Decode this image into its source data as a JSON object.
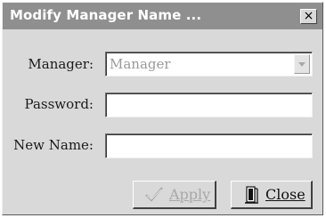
{
  "window": {
    "title": "Modify Manager Name ...",
    "close_glyph": "×"
  },
  "form": {
    "manager_label": "Manager:",
    "manager_value": "Manager",
    "password_label": "Password:",
    "password_value": "",
    "new_name_label": "New Name:",
    "new_name_value": ""
  },
  "buttons": {
    "apply_label": "Apply",
    "close_label": "Close"
  },
  "icons": {
    "apply": "checkmark-icon",
    "close": "door-exit-icon"
  },
  "colors": {
    "titlebar": "#8f8f8f",
    "dialog_bg": "#d9d9d9",
    "disabled_text": "#a8a8a8"
  }
}
